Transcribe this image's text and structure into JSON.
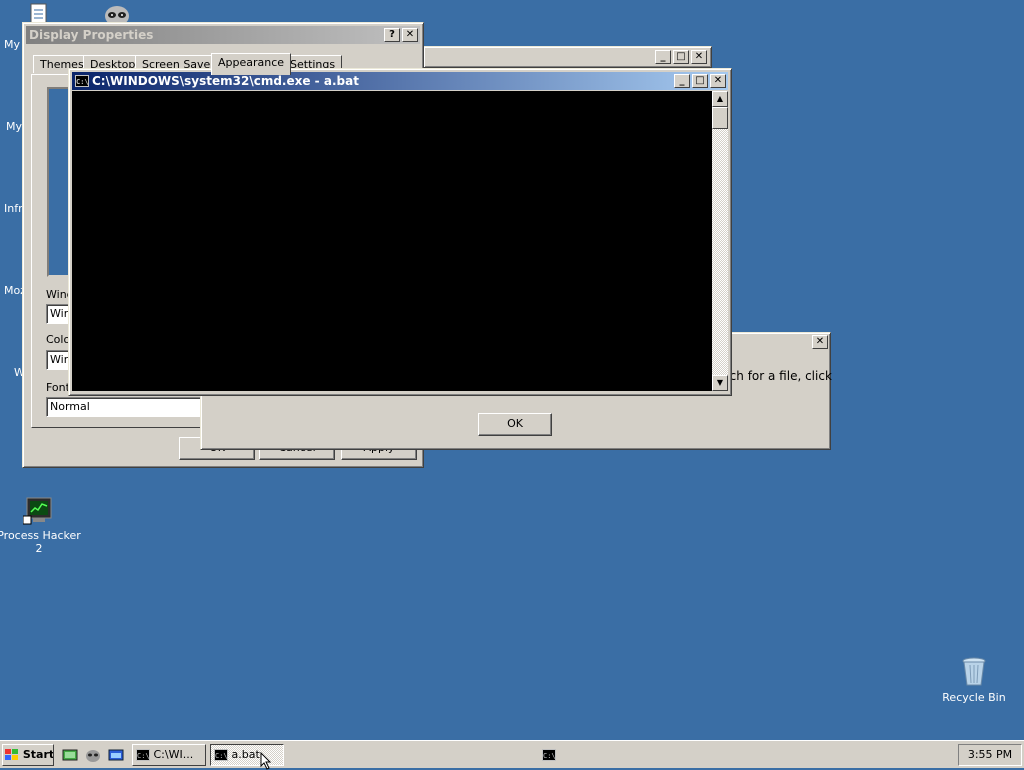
{
  "desktop": {
    "icons": [
      {
        "label": "Process Hacker 2"
      },
      {
        "label": "Recycle Bin"
      }
    ],
    "clipped_labels": [
      "My",
      "My",
      "Infr",
      "Moz",
      "W"
    ]
  },
  "display_properties": {
    "title": "Display Properties",
    "tabs": [
      "Themes",
      "Desktop",
      "Screen Saver",
      "Appearance",
      "Settings"
    ],
    "selected_tab": "Appearance",
    "labels": {
      "windows": "Wind",
      "color": "Colo",
      "font": "Font"
    },
    "fields": {
      "windows_value": "Wir",
      "color_value": "Wir",
      "font_value": "Normal"
    },
    "buttons": {
      "ok": "OK",
      "cancel": "Cancel",
      "apply": "Apply"
    },
    "help_glyph": "?",
    "close_glyph": "✕"
  },
  "cmd_window": {
    "title": "C:\\WINDOWS\\system32\\cmd.exe - a.bat",
    "icon": "cmd-icon",
    "icon_text": "C:\\"
  },
  "dialog": {
    "text": "rch for a file, click",
    "ok": "OK",
    "close_glyph": "✕"
  },
  "taskbar": {
    "start": "Start",
    "tasks": [
      {
        "label": "C:\\WI...",
        "pressed": false
      },
      {
        "label": "a.bat",
        "pressed": true
      }
    ],
    "clock": "3:55 PM"
  },
  "colors": {
    "desktop": "#3a6ea5",
    "active_title": "#0a246a",
    "inactive_title": "#808080",
    "face": "#d4d0c8"
  }
}
